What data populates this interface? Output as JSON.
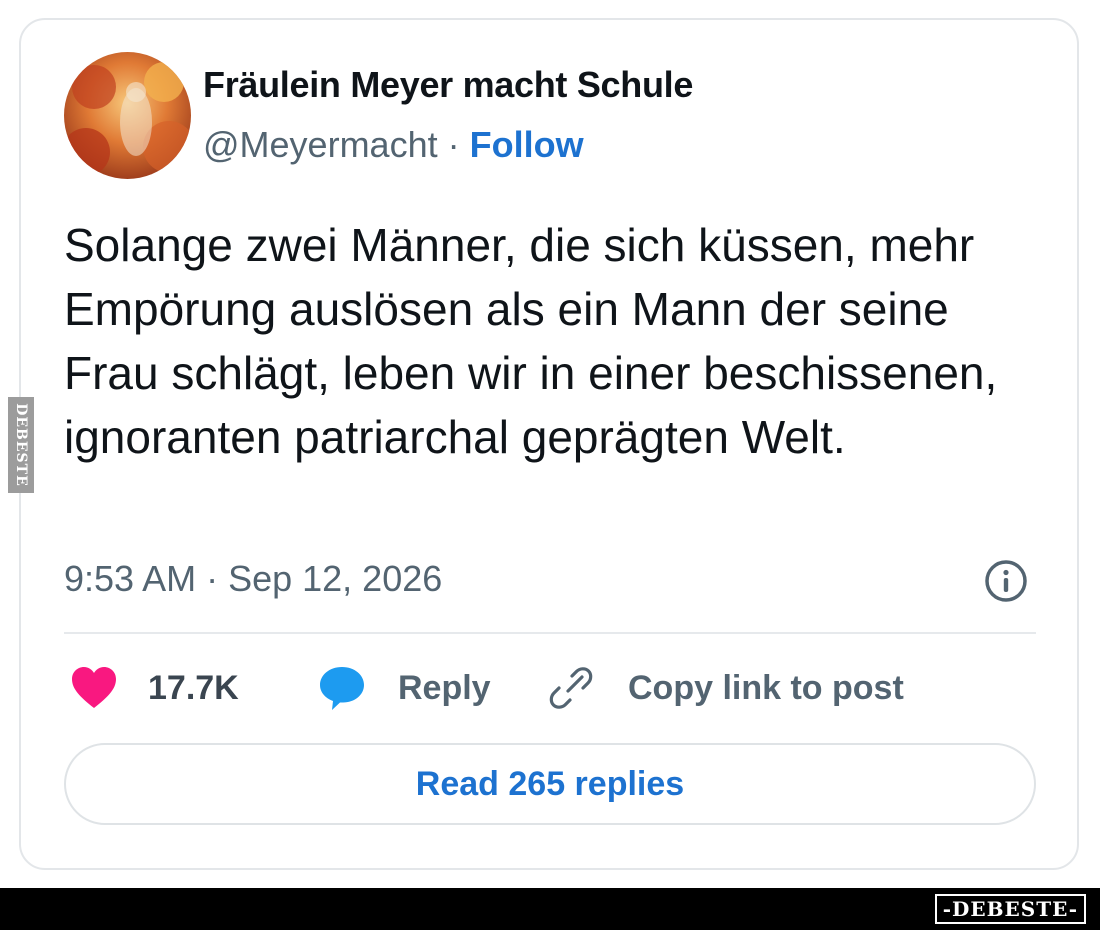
{
  "post": {
    "author": {
      "display_name": "Fräulein Meyer macht Schule",
      "handle": "@Meyermacht",
      "separator": "·",
      "follow_label": "Follow"
    },
    "text": "Solange zwei Männer, die sich küssen, mehr Empörung auslösen als ein Mann der seine Frau schlägt, leben wir in einer beschissenen, ignoranten patriarchal geprägten Welt.",
    "timestamp": "9:53 AM · Sep 12, 2026",
    "actions": {
      "like_count": "17.7K",
      "reply_label": "Reply",
      "copy_link_label": "Copy link to post"
    },
    "read_replies_label": "Read 265 replies"
  },
  "watermark": {
    "side_text": "DEBESTE",
    "footer_text": "-DEBESTE-"
  },
  "colors": {
    "follow_blue": "#1d72d0",
    "heart_pink": "#f91880",
    "reply_bubble_blue": "#1d9bf0",
    "muted_text": "#536471"
  },
  "icons": {
    "like": "heart-icon",
    "reply": "speech-bubble-icon",
    "copy": "link-icon",
    "info": "info-icon"
  }
}
